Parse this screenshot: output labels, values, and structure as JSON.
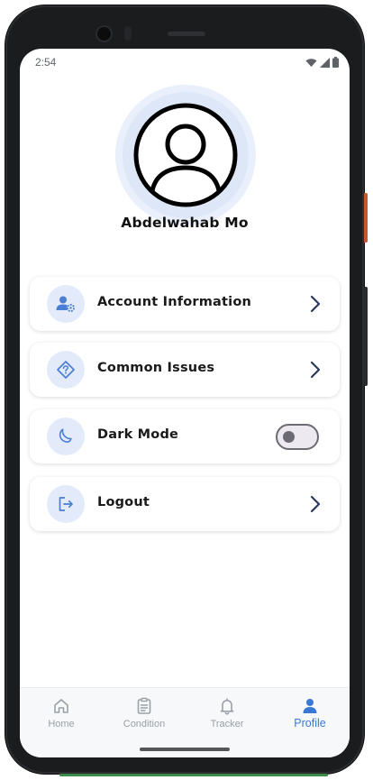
{
  "status_bar": {
    "time": "2:54",
    "icons": [
      "wifi-icon",
      "cell-signal-icon",
      "battery-icon"
    ]
  },
  "profile": {
    "name": "Abdelwahab Mo",
    "avatar_icon": "user-avatar-icon"
  },
  "menu": [
    {
      "label": "Account Information",
      "icon": "user-settings-icon",
      "trailing": "chevron"
    },
    {
      "label": "Common Issues",
      "icon": "help-diamond-icon",
      "trailing": "chevron"
    },
    {
      "label": "Dark Mode",
      "icon": "moon-icon",
      "trailing": "toggle",
      "toggle_on": false
    },
    {
      "label": "Logout",
      "icon": "logout-icon",
      "trailing": "chevron"
    }
  ],
  "bottom_nav": {
    "items": [
      {
        "label": "Home",
        "icon": "home-icon",
        "active": false
      },
      {
        "label": "Condition",
        "icon": "clipboard-icon",
        "active": false
      },
      {
        "label": "Tracker",
        "icon": "bell-icon",
        "active": false
      },
      {
        "label": "Profile",
        "icon": "person-icon",
        "active": true
      }
    ]
  },
  "colors": {
    "accent": "#3a78d6",
    "icon_bg": "#e3ebfa",
    "avatar_halo": "#dde7f8",
    "chevron": "#2b3a5c",
    "inactive_nav": "#9aa0a6"
  }
}
